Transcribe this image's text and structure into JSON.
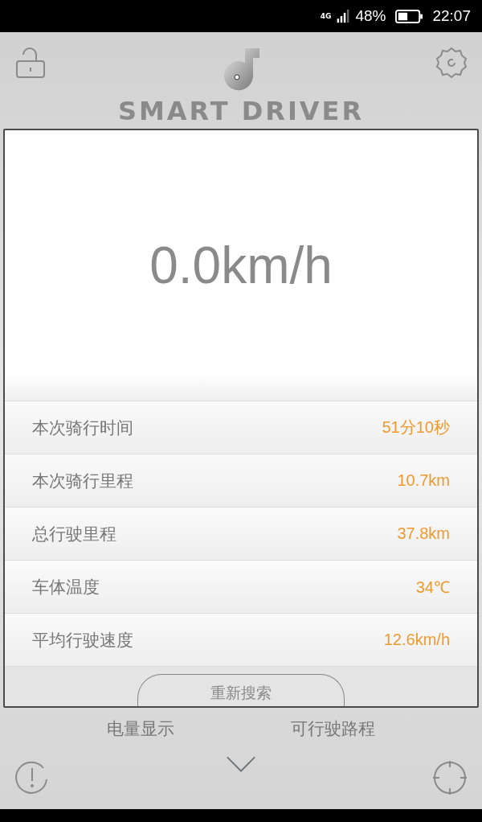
{
  "status_bar": {
    "network": "4G",
    "battery_text": "48%",
    "time": "22:07"
  },
  "header": {
    "logo_text": "SMART DRIVER"
  },
  "speed": "0.0km/h",
  "stats": [
    {
      "label": "本次骑行时间",
      "value": "51分10秒"
    },
    {
      "label": "本次骑行里程",
      "value": "10.7km"
    },
    {
      "label": "总行驶里程",
      "value": "37.8km"
    },
    {
      "label": "车体温度",
      "value": "34℃"
    },
    {
      "label": "平均行驶速度",
      "value": "12.6km/h"
    }
  ],
  "rescan_button": "重新搜索",
  "bottom_labels": [
    "电量显示",
    "可行驶路程"
  ]
}
